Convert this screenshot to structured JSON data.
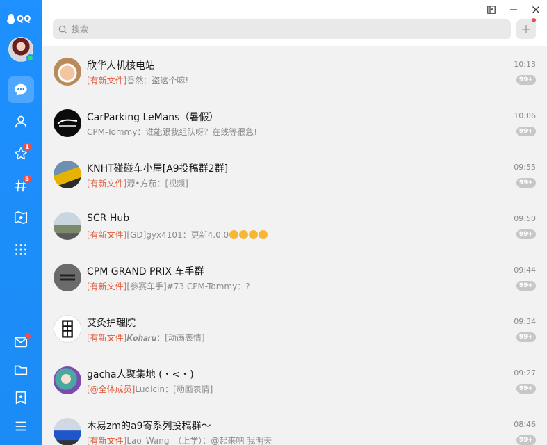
{
  "app": {
    "logo_text": "QQ"
  },
  "nav": {
    "favorites_badge": "1",
    "moments_badge": "5"
  },
  "search": {
    "placeholder": "搜索"
  },
  "chats": [
    {
      "name": "欣华人机核电站",
      "tag": "[有新文件]",
      "preview": "香然：盗这个嘛!",
      "time": "10:13",
      "count": "99+"
    },
    {
      "name": "CarParking LeMans（暑假）",
      "tag": "",
      "preview": "CPM-Tommy：谁能跟我组队呀？在线等很急!",
      "time": "10:06",
      "count": "99+"
    },
    {
      "name": "KNHT碰碰车小屋[A9投稿群2群]",
      "tag": "[有新文件]",
      "preview": "源•方茄：[视频]",
      "time": "09:55",
      "count": "99+"
    },
    {
      "name": "SCR Hub",
      "tag": "[有新文件]",
      "preview": "[GD]gyx4101：更新4.0.0",
      "time": "09:50",
      "count": "99+"
    },
    {
      "name": "CPM GRAND PRIX 车手群",
      "tag": "[有新文件]",
      "preview": "[参赛车手]#73 CPM-Tommy：?",
      "time": "09:44",
      "count": "99+"
    },
    {
      "name": "艾灸护理院",
      "tag": "[有新文件]",
      "preview": "𝑲𝒐𝒉𝒂𝒓𝒖：[动画表情]",
      "time": "09:34",
      "count": "99+"
    },
    {
      "name": "gacha人聚集地 (・<・)",
      "tag": "[@全体成员]",
      "preview": "Ludicin：[动画表情]",
      "time": "09:27",
      "count": "99+"
    },
    {
      "name": "木易zm的a9寄系列投稿群～",
      "tag": "[有新文件]",
      "preview": "Lao_Wang_（上学）：@起来吧 我明天",
      "time": "08:46",
      "count": "99+"
    }
  ]
}
